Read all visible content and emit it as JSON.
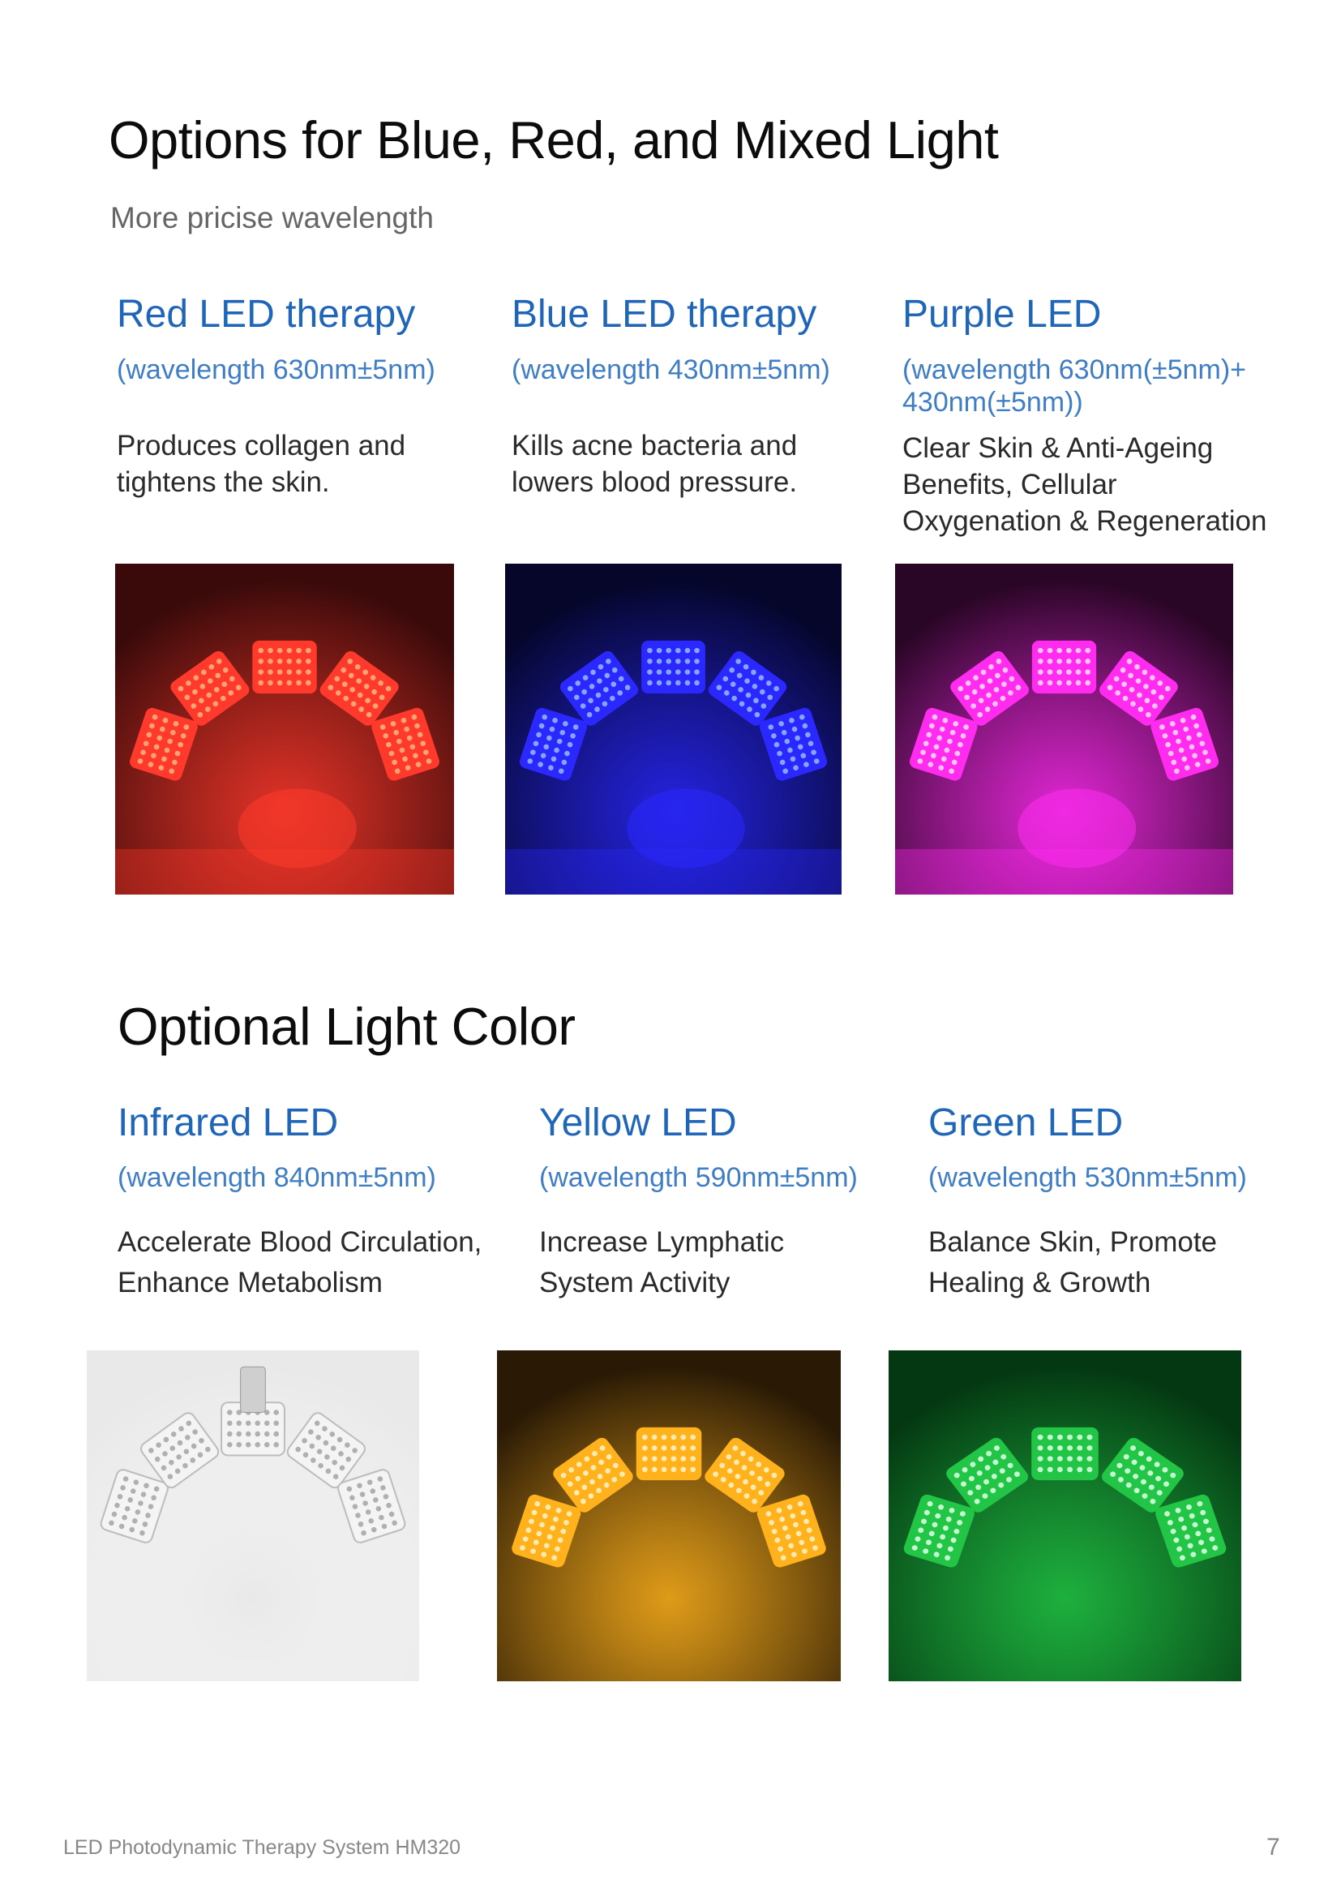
{
  "section1": {
    "title": "Options for Blue, Red, and Mixed Light",
    "subtitle": "More pricise wavelength",
    "cards": [
      {
        "title": "Red LED therapy",
        "wavelength": "(wavelength 630nm±5nm)",
        "description": "Produces collagen and tightens the skin.",
        "photo": {
          "alt": "red-led-photo",
          "bg": "#3a0a0a",
          "light": "#ff3a2c",
          "led": "#ffb07a"
        }
      },
      {
        "title": "Blue LED therapy",
        "wavelength": "(wavelength 430nm±5nm)",
        "description": "Kills acne bacteria and lowers blood pressure.",
        "photo": {
          "alt": "blue-led-photo",
          "bg": "#05062a",
          "light": "#2a28ff",
          "led": "#8fb4ff"
        }
      },
      {
        "title": "Purple LED",
        "wavelength": "(wavelength 630nm(±5nm)+ 430nm(±5nm))",
        "description": "Clear Skin & Anti-Ageing Benefits, Cellular Oxygenation & Regeneration",
        "photo": {
          "alt": "purple-led-photo",
          "bg": "#2a0626",
          "light": "#ff2cf0",
          "led": "#ffd6fb"
        }
      }
    ]
  },
  "section2": {
    "title": "Optional Light Color",
    "cards": [
      {
        "title": "Infrared LED",
        "wavelength": "(wavelength 840nm±5nm)",
        "description": "Accelerate Blood Circulation, Enhance Metabolism",
        "photo": {
          "alt": "infrared-led-device-photo",
          "bg": "#e9e9e9",
          "light": "#ffffff",
          "led": "#a9a9a9"
        }
      },
      {
        "title": "Yellow LED",
        "wavelength": "(wavelength 590nm±5nm)",
        "description": "Increase Lymphatic System Activity",
        "photo": {
          "alt": "yellow-led-photo",
          "bg": "#2a1a05",
          "light": "#ffb21c",
          "led": "#fff0c2"
        }
      },
      {
        "title": "Green LED",
        "wavelength": "(wavelength 530nm±5nm)",
        "description": "Balance Skin, Promote Healing & Growth",
        "photo": {
          "alt": "green-led-photo",
          "bg": "#043812",
          "light": "#22c545",
          "led": "#d8ffe0"
        }
      }
    ]
  },
  "footer": {
    "text": "LED Photodynamic Therapy System HM320",
    "page": "7"
  }
}
